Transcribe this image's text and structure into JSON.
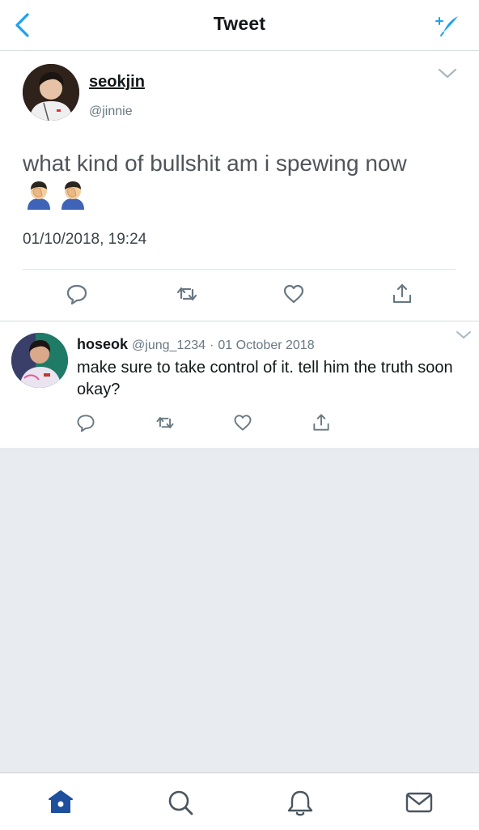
{
  "header": {
    "title": "Tweet"
  },
  "tweet": {
    "name": "seokjin",
    "handle": "@jinnie",
    "text": "what kind of bullshit am i spewing now",
    "timestamp": "01/10/2018, 19:24"
  },
  "reply": {
    "name": "hoseok",
    "handle": "@jung_1234",
    "separator": "·",
    "date": "01 October 2018",
    "text": "make sure to take control of it. tell him the truth soon okay?"
  },
  "colors": {
    "accent": "#1da1f2",
    "icon_gray": "#697882",
    "nav_active": "#1d4f9c"
  },
  "icons": {
    "header": [
      "back-chevron-icon",
      "compose-sparkle-icon"
    ],
    "actions": [
      "reply-icon",
      "retweet-icon",
      "like-icon",
      "share-icon"
    ],
    "tabs": [
      "home-icon",
      "search-icon",
      "notifications-icon",
      "messages-icon"
    ]
  }
}
